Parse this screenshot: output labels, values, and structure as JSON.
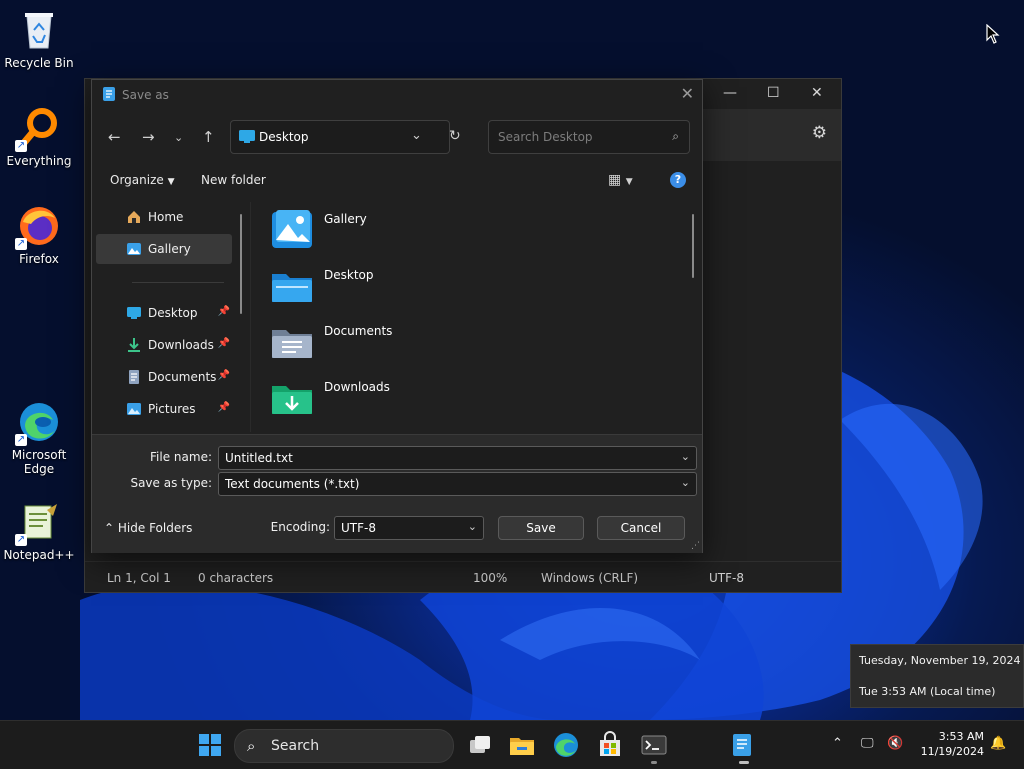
{
  "desktop": {
    "icons": [
      {
        "label": "Recycle Bin"
      },
      {
        "label": "Everything"
      },
      {
        "label": "Firefox"
      },
      {
        "label": "Microsoft Edge"
      },
      {
        "label": "Notepad++"
      }
    ]
  },
  "notepad": {
    "status": {
      "position": "Ln 1, Col 1",
      "chars": "0 characters",
      "zoom": "100%",
      "line_ending": "Windows (CRLF)",
      "encoding": "UTF-8"
    }
  },
  "dialog": {
    "title": "Save as",
    "address": "Desktop",
    "search_placeholder": "Search Desktop",
    "organize_label": "Organize",
    "new_folder_label": "New folder",
    "help_glyph": "?",
    "sidebar": [
      {
        "label": "Home",
        "icon": "home-icon"
      },
      {
        "label": "Gallery",
        "icon": "gallery-icon"
      },
      {
        "label": "Desktop",
        "icon": "desktop-icon"
      },
      {
        "label": "Downloads",
        "icon": "download-icon"
      },
      {
        "label": "Documents",
        "icon": "documents-icon"
      },
      {
        "label": "Pictures",
        "icon": "pictures-icon"
      }
    ],
    "files": [
      {
        "label": "Gallery"
      },
      {
        "label": "Desktop"
      },
      {
        "label": "Documents"
      },
      {
        "label": "Downloads"
      }
    ],
    "file_name_label": "File name:",
    "file_name_value": "Untitled.txt",
    "type_label": "Save as type:",
    "type_value": "Text documents (*.txt)",
    "encoding_label": "Encoding:",
    "encoding_value": "UTF-8",
    "save_label": "Save",
    "cancel_label": "Cancel",
    "hide_folders_label": "Hide Folders"
  },
  "tooltip": {
    "date": "Tuesday, November 19, 2024",
    "time": "Tue 3:53 AM (Local time)"
  },
  "taskbar": {
    "search_label": "Search",
    "clock_time": "3:53 AM",
    "clock_date": "11/19/2024"
  },
  "colors": {
    "accent": "#3b8ee8",
    "dialog_bg": "#202020",
    "taskbar_bg": "#1c1c1c"
  }
}
